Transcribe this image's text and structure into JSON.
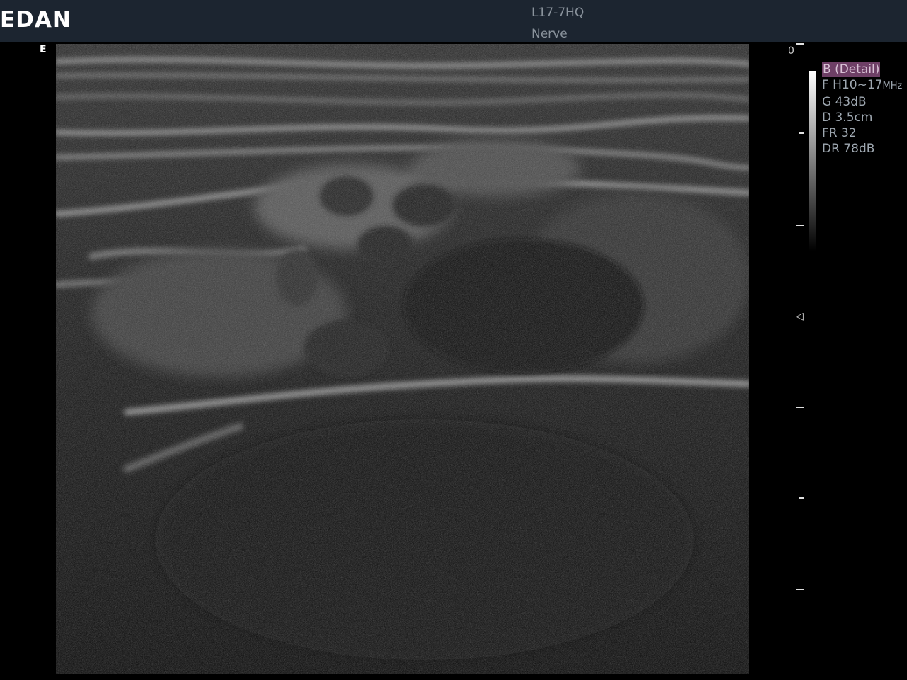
{
  "header": {
    "brand": "EDAN",
    "probe": "L17-7HQ",
    "preset": "Nerve"
  },
  "orientation_marker": "E",
  "depth_scale": {
    "zero_label": "0"
  },
  "focus_marker_icon": "focus-triangle-icon",
  "parameters": {
    "mode": "B (Detail)",
    "frequency_label": "F H10~17",
    "frequency_unit": "MHz",
    "gain": "G 43dB",
    "depth": "D 3.5cm",
    "frame_rate": "FR 32",
    "dynamic_range": "DR 78dB"
  },
  "colors": {
    "header_bg": "#1c2530",
    "mode_highlight": "#6e3f66",
    "param_text": "#9ea7b0"
  }
}
